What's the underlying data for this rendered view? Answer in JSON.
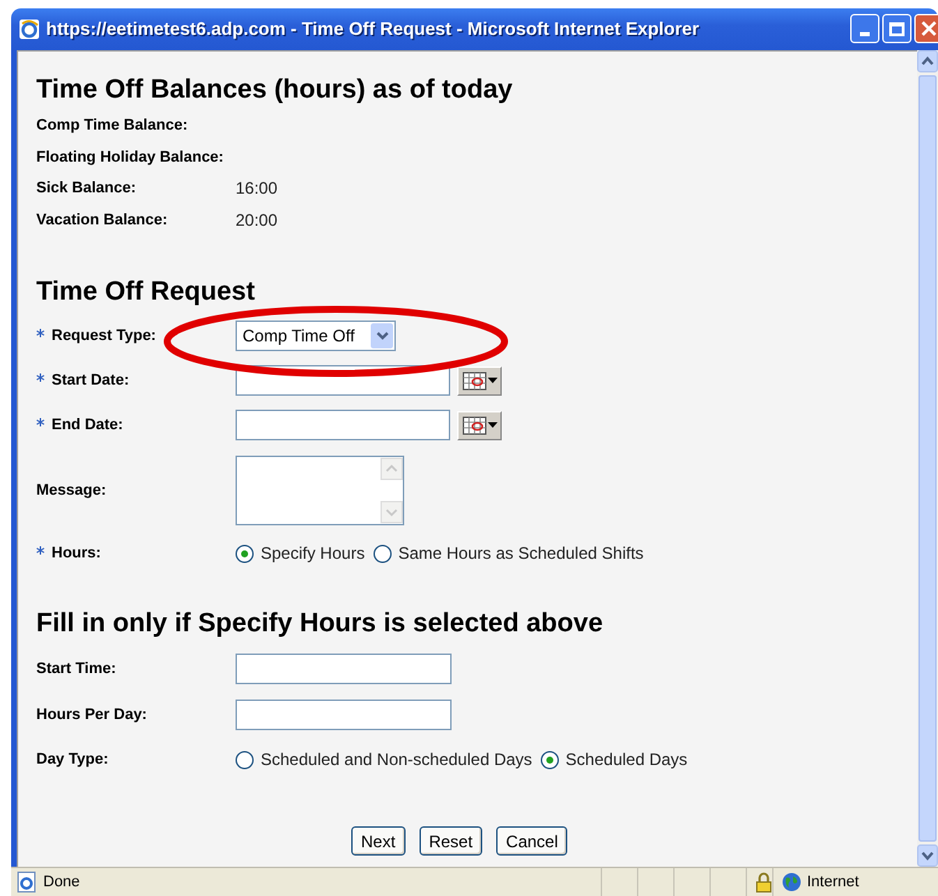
{
  "window": {
    "title": "https://eetimetest6.adp.com - Time Off Request - Microsoft Internet Explorer"
  },
  "balances": {
    "heading": "Time Off Balances (hours) as of today",
    "rows": [
      {
        "label": "Comp Time Balance:"
      },
      {
        "label": "Floating Holiday Balance:"
      },
      {
        "label": "Sick Balance:",
        "value": "16:00"
      },
      {
        "label": "Vacation Balance:",
        "value": "20:00"
      }
    ]
  },
  "request": {
    "heading": "Time Off Request",
    "fields": [
      {
        "kind": "select",
        "label": "Request Type:",
        "required": true,
        "value": "Comp Time Off"
      },
      {
        "kind": "date",
        "label": "Start Date:",
        "required": true
      },
      {
        "kind": "date",
        "label": "End Date:",
        "required": true
      },
      {
        "kind": "textarea",
        "label": "Message:",
        "required": false
      },
      {
        "kind": "radio",
        "label": "Hours:",
        "required": true,
        "options": [
          {
            "label": "Specify Hours",
            "selected": true
          },
          {
            "label": "Same Hours as Scheduled Shifts",
            "selected": false
          }
        ]
      }
    ]
  },
  "specify": {
    "heading": "Fill in only if Specify Hours is selected above",
    "fields": [
      {
        "kind": "text",
        "label": "Start Time:",
        "required": false
      },
      {
        "kind": "text",
        "label": "Hours Per Day:",
        "required": false
      },
      {
        "kind": "radio",
        "label": "Day Type:",
        "required": false,
        "options": [
          {
            "label": "Scheduled and Non-scheduled Days",
            "selected": false
          },
          {
            "label": "Scheduled Days",
            "selected": true
          }
        ]
      }
    ]
  },
  "buttons": [
    "Next",
    "Reset",
    "Cancel"
  ],
  "status_bar": {
    "text": "Done",
    "zone": "Internet"
  }
}
